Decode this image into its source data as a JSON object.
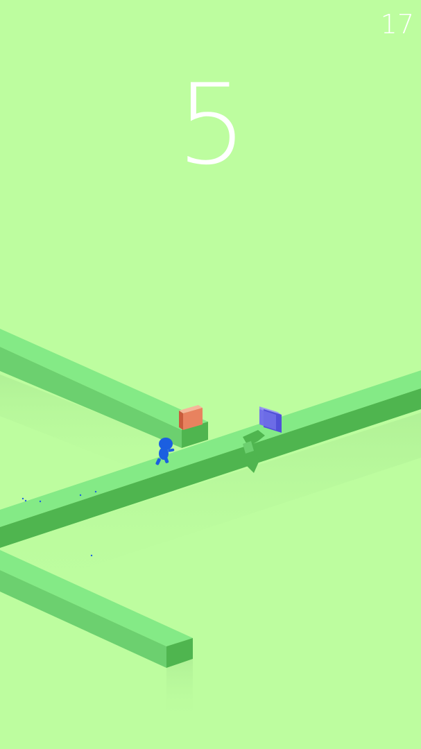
{
  "hud": {
    "score": "5",
    "best_score": "17"
  },
  "colors": {
    "background": "#bdfd9f",
    "path_top": "#84ea86",
    "path_side_dark": "#4fb54f",
    "path_side_light": "#6cd06f",
    "player": "#1b5fe0",
    "obstacle_orange": "#e8825f",
    "obstacle_blue": "#6f6fe8"
  },
  "sprites": {
    "player": "running-stick-figure",
    "obstacles": [
      "orange-cube",
      "blue-cube"
    ],
    "marker": "turn-arrow-signpost"
  }
}
